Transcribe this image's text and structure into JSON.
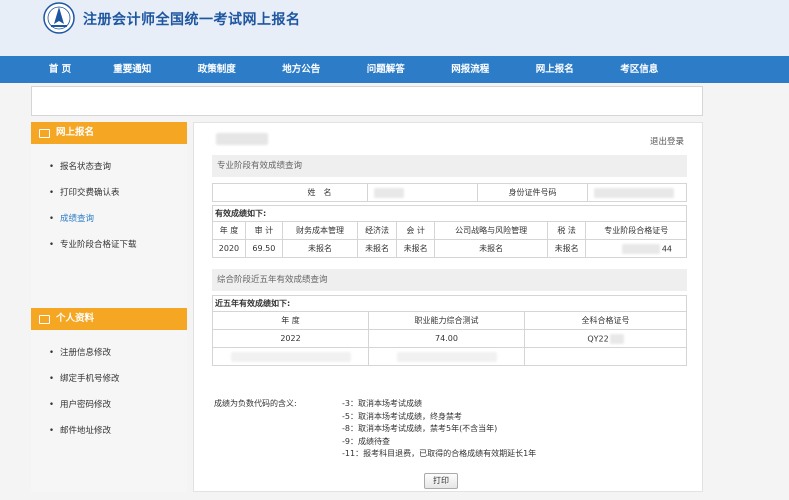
{
  "site": {
    "title": "注册会计师全国统一考试网上报名"
  },
  "nav": [
    "首 页",
    "重要通知",
    "政策制度",
    "地方公告",
    "问题解答",
    "网报流程",
    "网上报名",
    "考区信息"
  ],
  "sidebar": {
    "section1": {
      "title": "网上报名",
      "items": [
        "报名状态查询",
        "打印交费确认表",
        "成绩查询",
        "专业阶段合格证下载"
      ]
    },
    "section2": {
      "title": "个人资料",
      "items": [
        "注册信息修改",
        "绑定手机号修改",
        "用户密码修改",
        "邮件地址修改"
      ]
    }
  },
  "main": {
    "logout": "退出登录",
    "professional": {
      "section_title": "专业阶段有效成绩查询",
      "name_label": "姓　名",
      "id_label": "身份证件号码",
      "valid_label": "有效成绩如下:",
      "headers": [
        "年 度",
        "审 计",
        "财务成本管理",
        "经济法",
        "会 计",
        "公司战略与风险管理",
        "税 法",
        "专业阶段合格证号"
      ],
      "row": [
        "2020",
        "69.50",
        "未报名",
        "未报名",
        "未报名",
        "未报名",
        "未报名",
        "44"
      ]
    },
    "comprehensive": {
      "section_title": "综合阶段近五年有效成绩查询",
      "valid_label": "近五年有效成绩如下:",
      "headers": [
        "年 度",
        "职业能力综合测试",
        "全科合格证号"
      ],
      "row": [
        "2022",
        "74.00",
        "QY22"
      ]
    },
    "notes": {
      "lead": "成绩为负数代码的含义:",
      "items": [
        "-3：取消本场考试成绩",
        "-5：取消本场考试成绩，终身禁考",
        "-8：取消本场考试成绩，禁考5年(不含当年)",
        "-9：成绩待查",
        "-11：报考科目退费，已取得的合格成绩有效期延长1年"
      ]
    },
    "print_label": "打印"
  }
}
